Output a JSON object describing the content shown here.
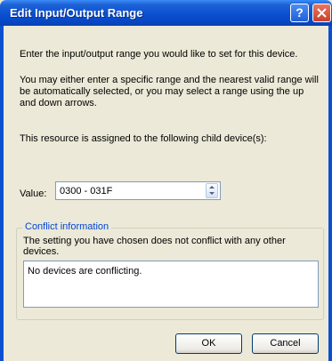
{
  "window": {
    "title": "Edit Input/Output Range",
    "help_label": "?",
    "close_label": "✕"
  },
  "body": {
    "intro": "Enter the input/output range you would like to set for this device.",
    "explain": "You may either enter a specific range and the nearest valid range will be automatically selected, or you may select a range using the up and down arrows.",
    "assigned": "This resource is assigned to the following child device(s):"
  },
  "value": {
    "label": "Value:",
    "current": "0300 - 031F"
  },
  "conflict": {
    "legend": "Conflict information",
    "description": "The setting you have chosen does not conflict with any other devices.",
    "message": "No devices are conflicting."
  },
  "buttons": {
    "ok": "OK",
    "cancel": "Cancel"
  }
}
